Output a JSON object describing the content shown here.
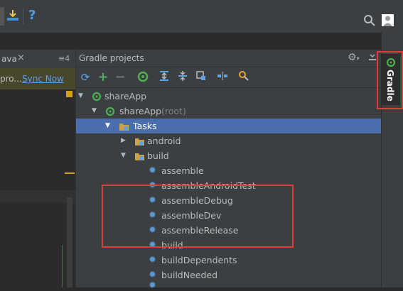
{
  "toolbar": {
    "help_label": "?",
    "search_icon": "search-icon",
    "user_icon": "user-icon"
  },
  "editor": {
    "tab_label": "ava",
    "tab_close": "×",
    "tab_count": "≡4",
    "notice_text": "pro...",
    "sync_link": "Sync Now"
  },
  "gradle": {
    "title": "Gradle projects",
    "settings_icon": "gear-icon",
    "tree": [
      {
        "label": "shareApp",
        "suffix": ""
      },
      {
        "label": "shareApp",
        "suffix": "(root)"
      },
      {
        "label": "Tasks",
        "suffix": ""
      },
      {
        "label": "android",
        "suffix": ""
      },
      {
        "label": "build",
        "suffix": ""
      },
      {
        "label": "assemble",
        "suffix": ""
      },
      {
        "label": "assembleAndroidTest",
        "suffix": ""
      },
      {
        "label": "assembleDebug",
        "suffix": ""
      },
      {
        "label": "assembleDev",
        "suffix": ""
      },
      {
        "label": "assembleRelease",
        "suffix": ""
      },
      {
        "label": "build",
        "suffix": ""
      },
      {
        "label": "buildDependents",
        "suffix": ""
      },
      {
        "label": "buildNeeded",
        "suffix": ""
      }
    ]
  },
  "side_tab": {
    "label": "Gradle"
  },
  "colors": {
    "selection": "#4b6eaf",
    "highlight_box": "#e03c3c",
    "gradle_green": "#4caf50",
    "link": "#589df6"
  }
}
